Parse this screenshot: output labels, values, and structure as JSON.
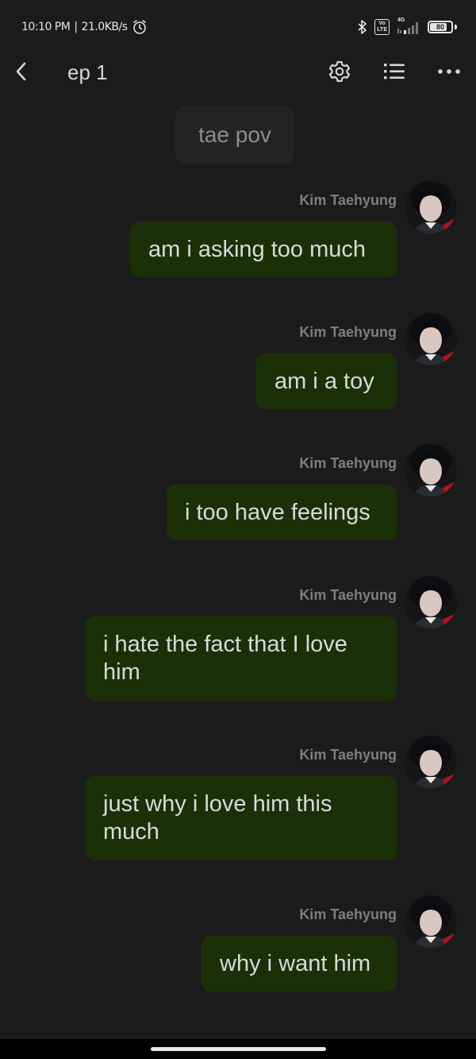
{
  "status_bar": {
    "time": "10:10 PM",
    "separator": "|",
    "speed": "21.0KB/s",
    "volte_line1": "Vo",
    "volte_line2": "LTE",
    "network": "4G",
    "battery": "80",
    "battery_level": 0.8
  },
  "header": {
    "title": "ep 1"
  },
  "chat": {
    "system_message": "tae pov",
    "messages": [
      {
        "sender": "Kim Taehyung",
        "text": "am i asking too much"
      },
      {
        "sender": "Kim Taehyung",
        "text": "am i a toy"
      },
      {
        "sender": "Kim Taehyung",
        "text": "i too have feelings"
      },
      {
        "sender": "Kim Taehyung",
        "text": "i hate the fact that I love him"
      },
      {
        "sender": "Kim Taehyung",
        "text": "just why i love him this much"
      },
      {
        "sender": "Kim Taehyung",
        "text": "why i want him"
      }
    ]
  },
  "colors": {
    "background": "#1b1b1b",
    "bubble": "#1c3008",
    "system_bubble": "#232323"
  }
}
